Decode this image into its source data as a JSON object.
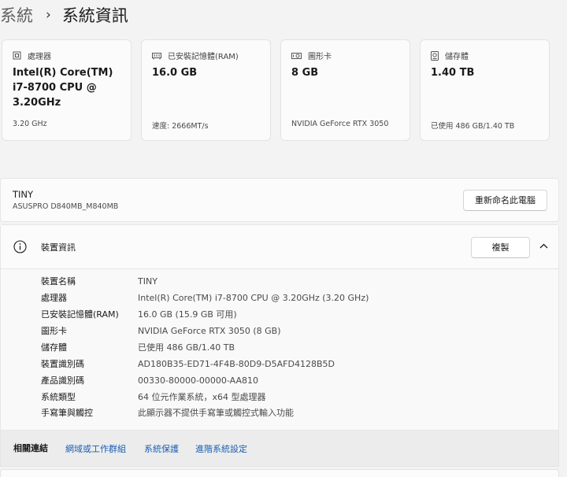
{
  "breadcrumb": {
    "parent": "系統",
    "separator": "›",
    "current": "系統資訊"
  },
  "cards": [
    {
      "icon": "processor-icon",
      "label": "處理器",
      "value": "Intel(R) Core(TM) i7-8700 CPU @ 3.20GHz",
      "sub": "3.20 GHz"
    },
    {
      "icon": "ram-icon",
      "label": "已安裝記憶體(RAM)",
      "value": "16.0 GB",
      "sub": "速度: 2666MT/s"
    },
    {
      "icon": "graphics-card-icon",
      "label": "圖形卡",
      "value": "8 GB",
      "sub": "NVIDIA GeForce RTX 3050"
    },
    {
      "icon": "storage-icon",
      "label": "儲存體",
      "value": "1.40 TB",
      "sub": "已使用 486 GB/1.40 TB"
    }
  ],
  "device": {
    "name": "TINY",
    "model": "ASUSPRO D840MB_M840MB",
    "rename_label": "重新命名此電腦"
  },
  "specs": {
    "title": "裝置資訊",
    "copy_label": "複製",
    "rows": [
      {
        "key": "裝置名稱",
        "value": "TINY"
      },
      {
        "key": "處理器",
        "value": "Intel(R) Core(TM) i7-8700 CPU @ 3.20GHz (3.20 GHz)"
      },
      {
        "key": "已安裝記憶體(RAM)",
        "value": "16.0 GB (15.9 GB 可用)"
      },
      {
        "key": "圖形卡",
        "value": "NVIDIA GeForce RTX 3050 (8 GB)"
      },
      {
        "key": "儲存體",
        "value": "已使用 486 GB/1.40 TB"
      },
      {
        "key": "裝置識別碼",
        "value": "AD180B35-ED71-4F4B-80D9-D5AFD4128B5D"
      },
      {
        "key": "產品識別碼",
        "value": "00330-80000-00000-AA810"
      },
      {
        "key": "系統類型",
        "value": "64 位元作業系統，x64 型處理器"
      },
      {
        "key": "手寫筆與觸控",
        "value": "此顯示器不提供手寫筆或觸控式輸入功能"
      }
    ]
  },
  "related": {
    "label": "相關連結",
    "links": [
      "網域或工作群組",
      "系統保護",
      "進階系統設定"
    ]
  },
  "colors": {
    "accent_link": "#1a5fb4",
    "background": "#f3f3f3",
    "card": "#fbfbfb"
  }
}
